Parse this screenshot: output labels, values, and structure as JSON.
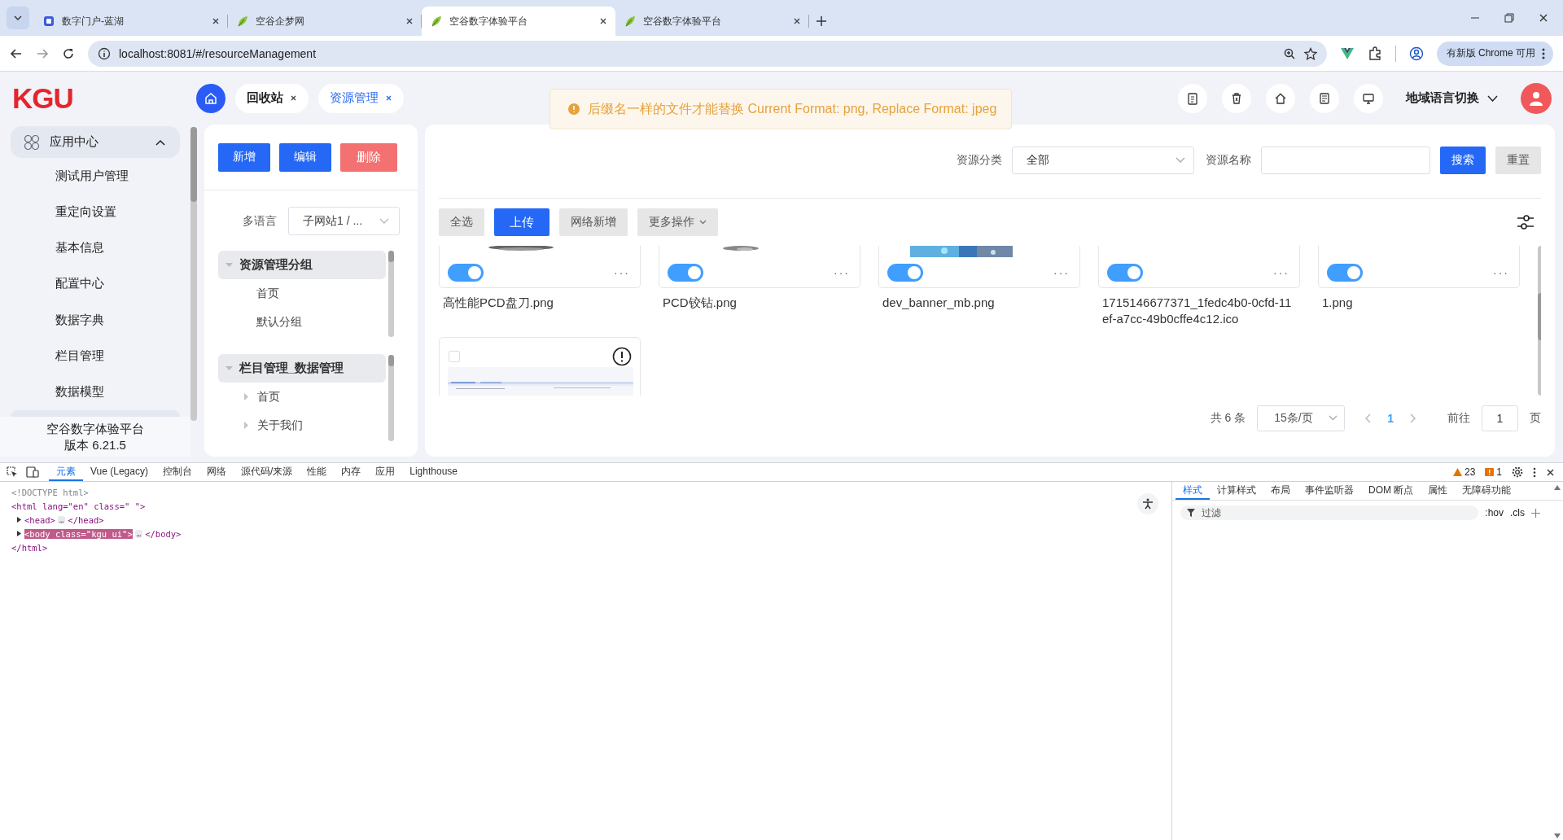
{
  "browser": {
    "tabs": [
      {
        "title": "数字门户-蓝湖",
        "selected": false
      },
      {
        "title": "空谷企梦网",
        "selected": false
      },
      {
        "title": "空谷数字体验平台",
        "selected": true
      },
      {
        "title": "空谷数字体验平台",
        "selected": false
      }
    ],
    "url": "localhost:8081/#/resourceManagement",
    "update_button": "有新版 Chrome 可用"
  },
  "app": {
    "logo": "KGU",
    "tabs": [
      {
        "label": "回收站",
        "selected": false
      },
      {
        "label": "资源管理",
        "selected": true
      }
    ],
    "toast": "后缀名一样的文件才能替换 Current Format: png, Replace Format: jpeg",
    "language": {
      "label": "地域语言切换",
      "expanded": false
    }
  },
  "sidebar": {
    "group": {
      "label": "应用中心",
      "expanded": true
    },
    "items": [
      "测试用户管理",
      "重定向设置",
      "基本信息",
      "配置中心",
      "数据字典",
      "栏目管理",
      "数据模型"
    ],
    "footer_title": "空谷数字体验平台",
    "footer_version": "版本 6.21.5"
  },
  "tree_panel": {
    "buttons": [
      {
        "label": "新增",
        "kind": "primary"
      },
      {
        "label": "编辑",
        "kind": "primary"
      },
      {
        "label": "删除",
        "kind": "danger"
      }
    ],
    "language_label": "多语言",
    "language_value": "子网站1 / ...",
    "groups": [
      {
        "label": "资源管理分组",
        "expanded": true,
        "children": [
          {
            "label": "首页"
          },
          {
            "label": "默认分组"
          }
        ]
      },
      {
        "label": "栏目管理_数据管理",
        "expanded": true,
        "children": [
          {
            "label": "首页",
            "expanded": false
          },
          {
            "label": "关于我们",
            "expanded": false
          }
        ]
      }
    ]
  },
  "resources": {
    "category_label": "资源分类",
    "category_value": "全部",
    "name_label": "资源名称",
    "search_button": "搜索",
    "reset_button": "重置",
    "toolbar": [
      {
        "label": "全选",
        "kind": "default"
      },
      {
        "label": "上传",
        "kind": "primary"
      },
      {
        "label": "网络新增",
        "kind": "default"
      },
      {
        "label": "更多操作",
        "kind": "dropdown"
      }
    ],
    "cards": [
      {
        "kind": "file",
        "on": true,
        "more": "···",
        "name": "高性能PCD盘刀.png"
      },
      {
        "kind": "file",
        "on": true,
        "more": "···",
        "name": "PCD铰钻.png"
      },
      {
        "kind": "file",
        "on": true,
        "more": "···",
        "name": "dev_banner_mb.png"
      },
      {
        "kind": "file",
        "on": true,
        "more": "···",
        "name": "1715146677371_1fedc4b0-0cfd-11ef-a7cc-49b0cffe4c12.ico"
      },
      {
        "kind": "file",
        "on": true,
        "more": "···",
        "name": "1.png"
      },
      {
        "kind": "pending",
        "checked": false
      }
    ],
    "pagination": {
      "total": "共 6 条",
      "page_size": "15条/页",
      "pages": [
        {
          "label": "1",
          "selected": true
        }
      ],
      "goto_label": "前往",
      "goto_value": "1",
      "goto_suffix": "页"
    }
  },
  "devtools": {
    "tabs": [
      {
        "label": "元素",
        "selected": true
      },
      {
        "label": "Vue (Legacy)",
        "selected": false
      },
      {
        "label": "控制台",
        "selected": false
      },
      {
        "label": "网络",
        "selected": false
      },
      {
        "label": "源代码/来源",
        "selected": false
      },
      {
        "label": "性能",
        "selected": false
      },
      {
        "label": "内存",
        "selected": false
      },
      {
        "label": "应用",
        "selected": false
      },
      {
        "label": "Lighthouse",
        "selected": false
      }
    ],
    "warnings": "23",
    "errors": "1",
    "dom": [
      {
        "kind": "doctype",
        "text": "<!DOCTYPE html>"
      },
      {
        "kind": "open",
        "text": "<html lang=\"en\" class=\" \">"
      },
      {
        "kind": "element",
        "open": "<head>",
        "ellipsis": "…",
        "close": "</head>",
        "expanded": false,
        "selected": false
      },
      {
        "kind": "element",
        "open": "<body class=\"kgu_ui\">",
        "ellipsis": "…",
        "close": "</body>",
        "expanded": false,
        "selected": true
      },
      {
        "kind": "close",
        "text": "</html>"
      }
    ],
    "style_tabs": [
      {
        "label": "样式",
        "selected": true
      },
      {
        "label": "计算样式",
        "selected": false
      },
      {
        "label": "布局",
        "selected": false
      },
      {
        "label": "事件监听器",
        "selected": false
      },
      {
        "label": "DOM 断点",
        "selected": false
      },
      {
        "label": "属性",
        "selected": false
      },
      {
        "label": "无障碍功能",
        "selected": false
      }
    ],
    "filter_placeholder": "过滤",
    "hov": ":hov",
    "cls": ".cls"
  }
}
